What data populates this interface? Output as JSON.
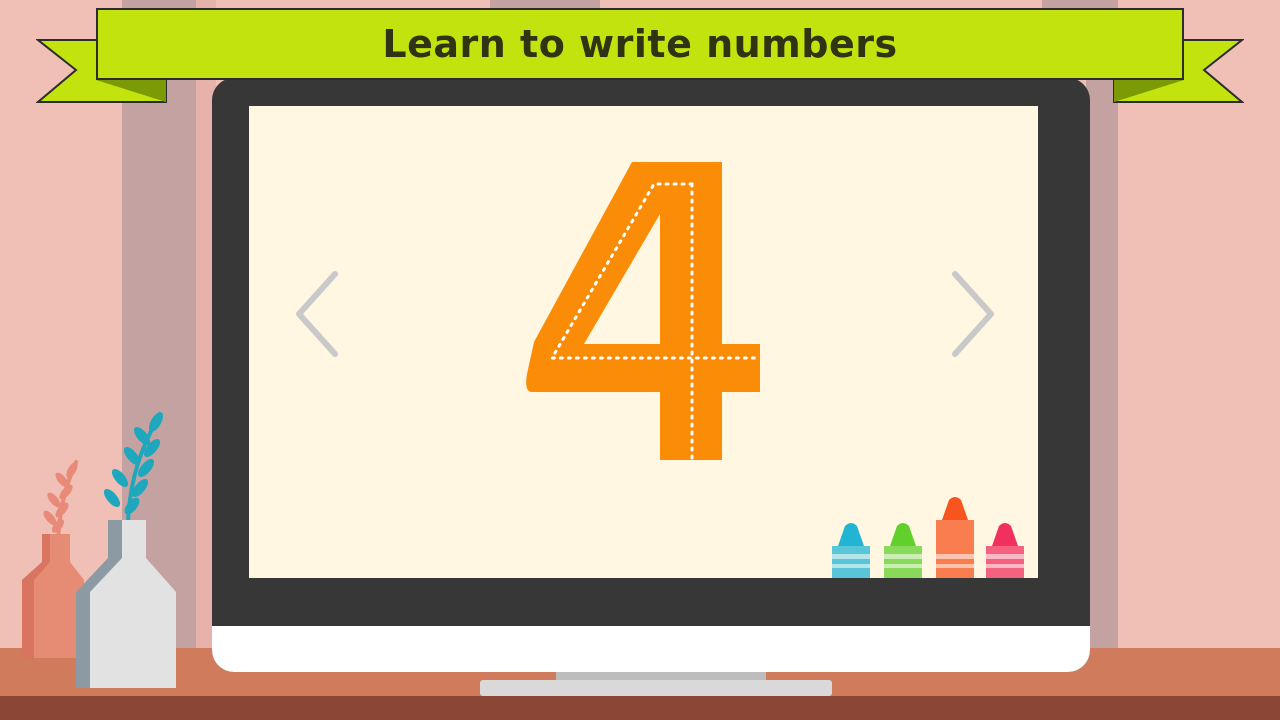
{
  "banner": {
    "title": "Learn to write numbers"
  },
  "lesson": {
    "digit": "4"
  },
  "nav": {
    "prev_icon": "chevron-left-icon",
    "next_icon": "chevron-right-icon"
  },
  "crayons": [
    {
      "name": "crayon-blue",
      "color": "#21b5d3"
    },
    {
      "name": "crayon-green",
      "color": "#62d02c"
    },
    {
      "name": "crayon-orange",
      "color": "#f7541e"
    },
    {
      "name": "crayon-pink",
      "color": "#f0305e"
    }
  ],
  "colors": {
    "digit": "#fa8c07",
    "banner": "#c3e30f",
    "screen": "#fff7e1",
    "wall": "#f0bfb6"
  }
}
